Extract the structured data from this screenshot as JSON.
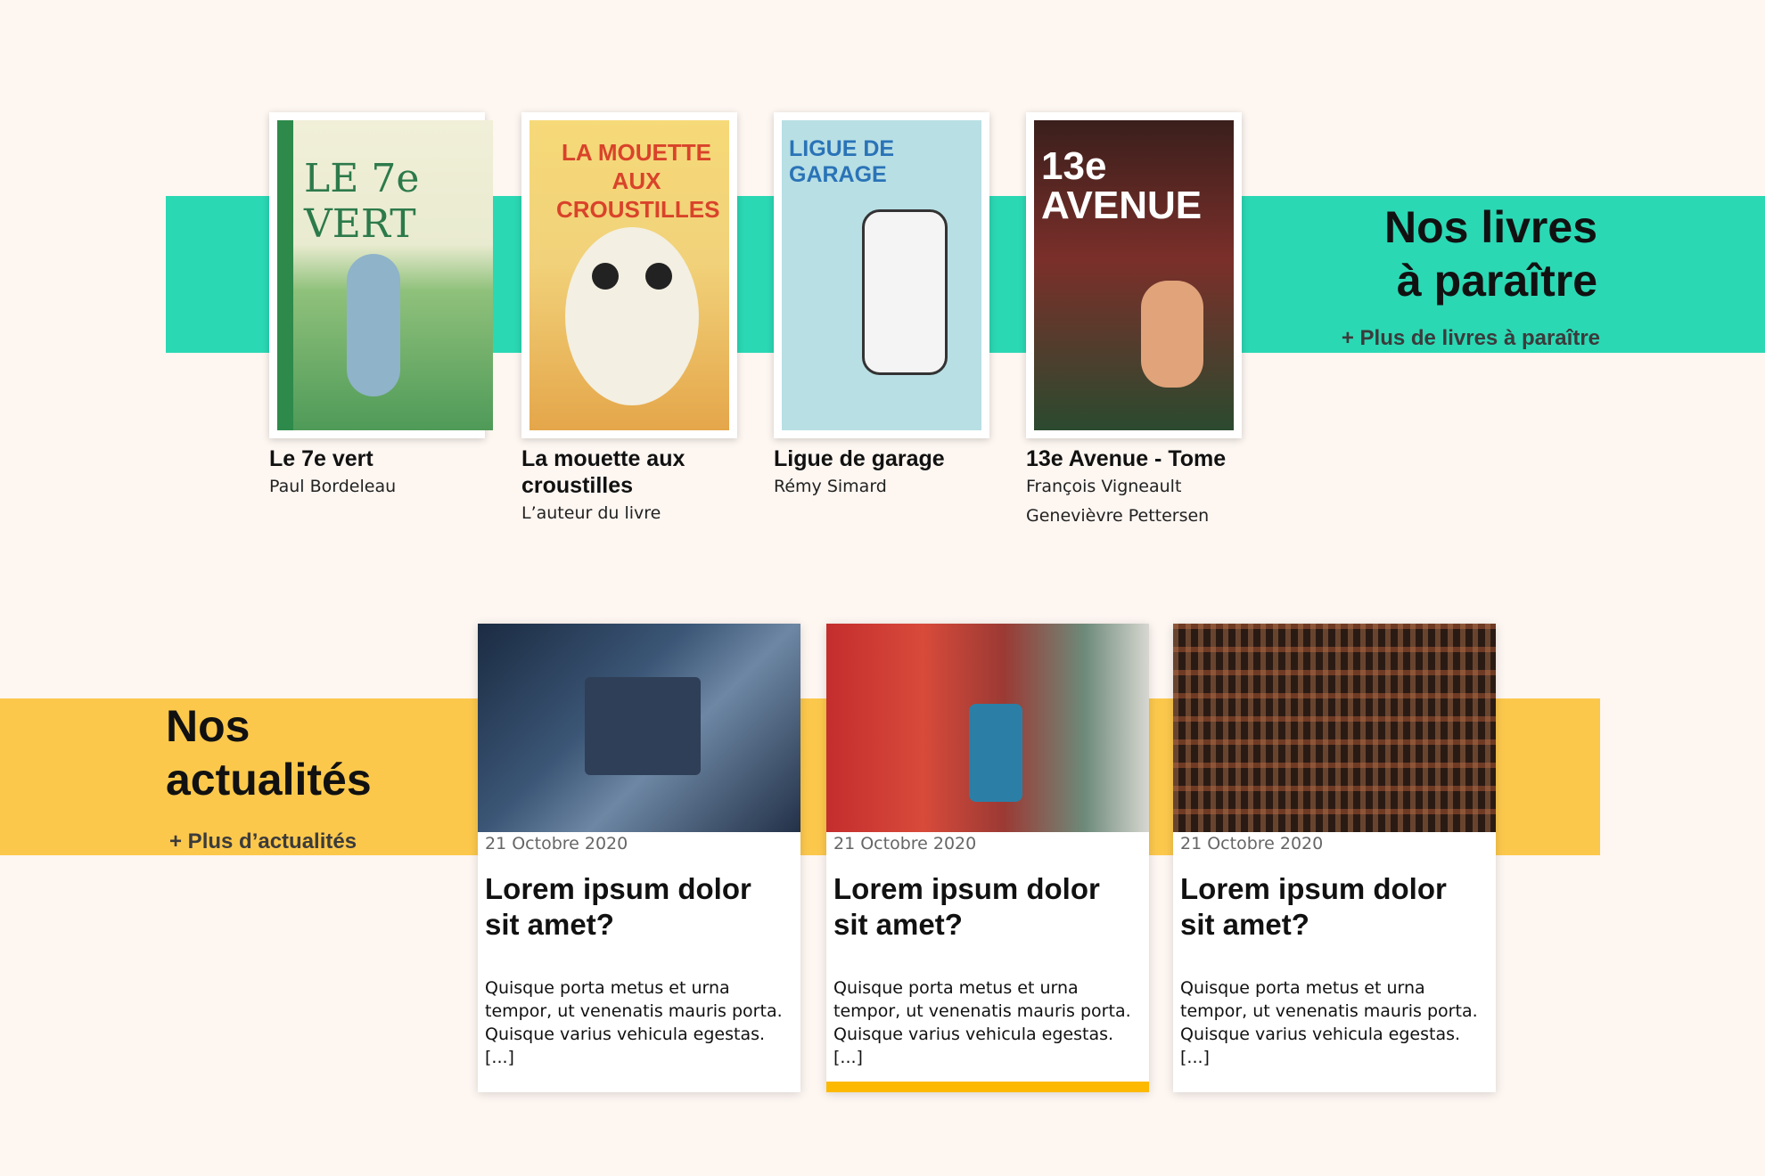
{
  "upcoming": {
    "title_line1": "Nos livres",
    "title_line2": "à paraître",
    "more_link": "+ Plus de livres à paraître",
    "books": [
      {
        "cover_text": "LE 7e VERT",
        "title": "Le 7e vert",
        "authors": [
          "Paul Bordeleau"
        ]
      },
      {
        "cover_text": "LA MOUETTE AUX CROUSTILLES",
        "title": "La mouette aux croustilles",
        "authors": [
          "L’auteur du livre"
        ]
      },
      {
        "cover_text": "LIGUE DE GARAGE",
        "title": "Ligue de garage",
        "authors": [
          "Rémy Simard"
        ]
      },
      {
        "cover_text": "13e AVENUE",
        "title": "13e Avenue - Tome",
        "authors": [
          "François Vigneault",
          "Genevièvre Pettersen"
        ]
      }
    ]
  },
  "news": {
    "title_line1": "Nos",
    "title_line2": "actualités",
    "more_link": "+ Plus d’actualités",
    "cards": [
      {
        "date": "21 Octobre 2020",
        "title": "Lorem ipsum dolor sit amet?",
        "text": "Quisque porta metus et urna tempor, ut venenatis mauris porta. Quisque varius vehicula egestas. [...]"
      },
      {
        "date": "21 Octobre 2020",
        "title": "Lorem ipsum dolor sit amet?",
        "text": "Quisque porta metus et urna tempor, ut venenatis mauris porta. Quisque varius vehicula egestas. [...]"
      },
      {
        "date": "21 Octobre 2020",
        "title": "Lorem ipsum dolor sit amet?",
        "text": "Quisque porta metus et urna tempor, ut venenatis mauris porta. Quisque varius vehicula egestas. [...]"
      }
    ]
  },
  "colors": {
    "background": "#fdf6f1",
    "teal": "#2bd8b4",
    "yellow": "#fcc84c",
    "accent": "#fcb900"
  }
}
